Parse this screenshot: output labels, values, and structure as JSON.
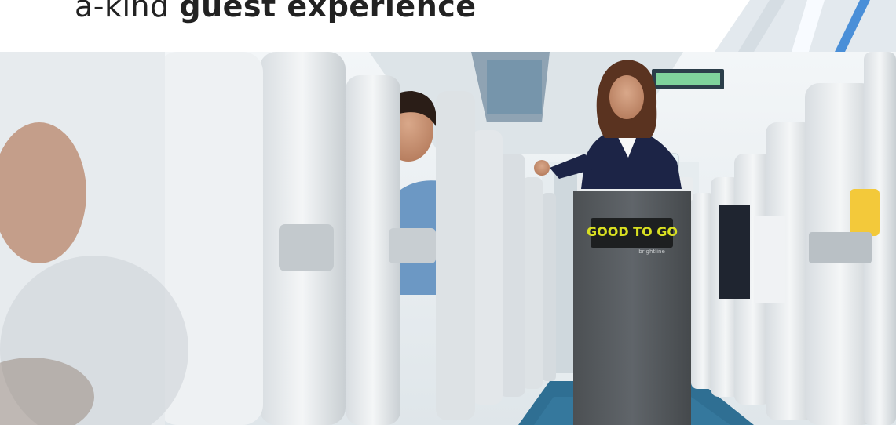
{
  "headline": {
    "prefix": "a-kind",
    "bold": "guest experience"
  },
  "photo": {
    "cart_sign_text": "GOOD TO GO",
    "cart_sub_text": "brightline",
    "colors": {
      "ceiling": "#eef2f5",
      "seat_fabric": "#e9eef1",
      "carpet": "#2f6f93",
      "cart_body": "#565a5d",
      "attendant_jacket": "#1c2446",
      "passenger_shirt": "#6c98c4",
      "sign_text": "#d9e021"
    }
  }
}
